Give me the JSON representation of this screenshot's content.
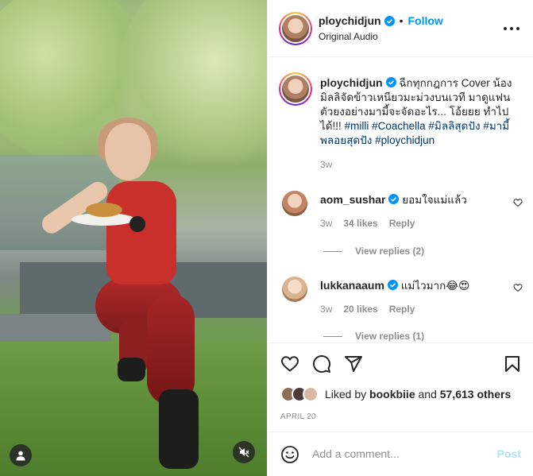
{
  "header": {
    "username": "ploychidjun",
    "follow_label": "Follow",
    "separator": "•",
    "audio_label": "Original Audio"
  },
  "caption": {
    "username": "ploychidjun",
    "text": "ฉีกทุกกฎการ Cover น้อง มิลลิจัดข้าวเหนียวมะม่วงบนเวที มาดูแฟนตัวยงอย่างมามี้จะจัดอะไร... โอ้ยยย ทำไปได้!!!",
    "hashtags": [
      "#milli",
      "#Coachella",
      "#มิลลิสุดปัง",
      "#มามี้พลอยสุดปัง",
      "#ploychidjun"
    ],
    "time": "3w"
  },
  "comments": [
    {
      "username": "aom_sushar",
      "text": "ยอมใจแม่แล้ว",
      "time": "3w",
      "likes": "34 likes",
      "reply_label": "Reply",
      "view_replies": "View replies (2)"
    },
    {
      "username": "lukkanaaum",
      "text": "แม่ไวมาก😂😍",
      "time": "3w",
      "likes": "20 likes",
      "reply_label": "Reply",
      "view_replies": "View replies (1)"
    }
  ],
  "actions": {
    "icons": [
      "heart-icon",
      "comment-icon",
      "share-icon",
      "bookmark-icon"
    ],
    "liked_by_prefix": "Liked by",
    "liked_by_user": "bookbiie",
    "liked_by_and": "and",
    "liked_by_count": "57,613 others",
    "date": "APRIL 20"
  },
  "add_comment": {
    "placeholder": "Add a comment...",
    "post_label": "Post"
  },
  "colors": {
    "link_blue": "#0095f6",
    "hashtag": "#00376b",
    "muted": "#8e8e8e",
    "post_disabled": "#b2dffc"
  }
}
